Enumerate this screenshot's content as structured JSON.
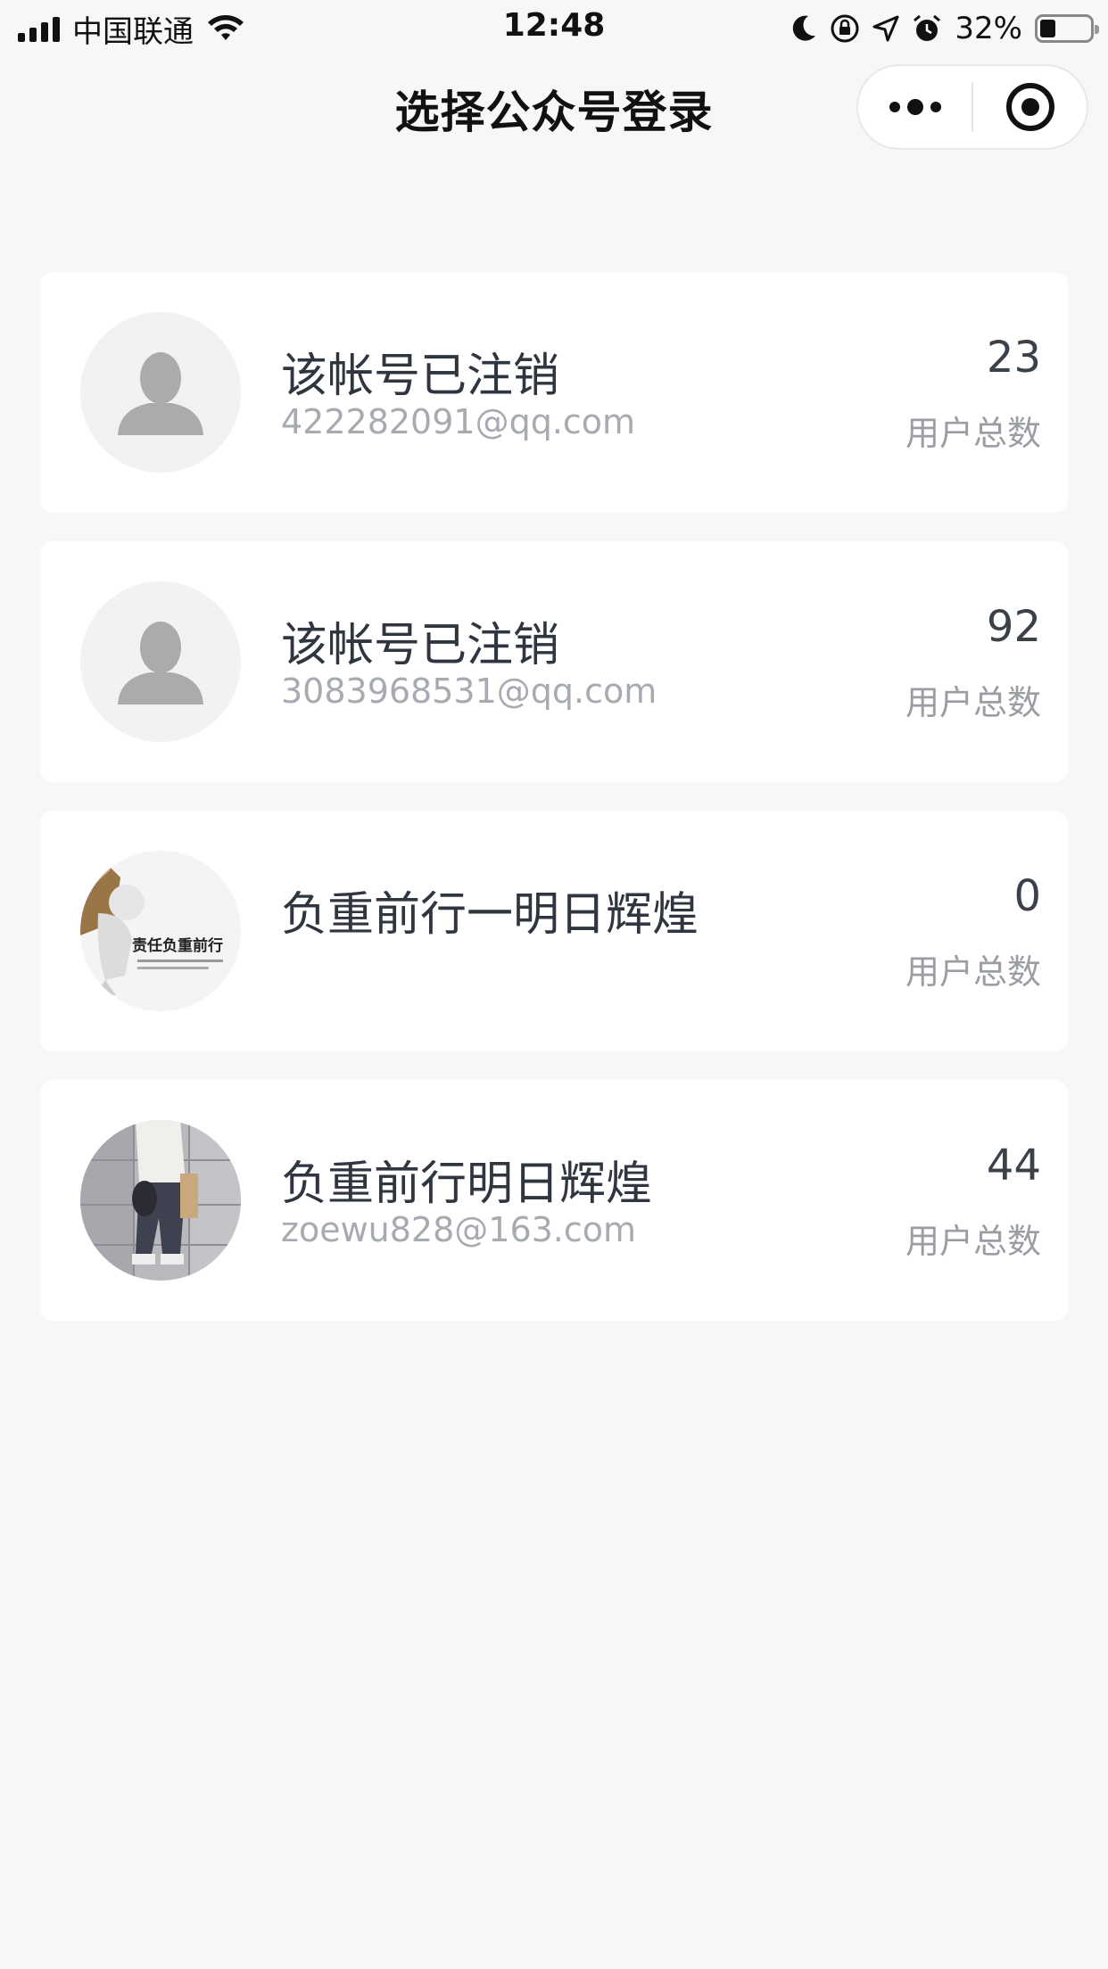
{
  "status_bar": {
    "carrier": "中国联通",
    "time": "12:48",
    "battery": "32%",
    "battery_level": 0.32,
    "icons": [
      "signal-icon",
      "wifi-icon",
      "moon-icon",
      "rotation-lock-icon",
      "location-icon",
      "alarm-icon",
      "battery-icon"
    ]
  },
  "nav": {
    "title": "选择公众号登录",
    "icons": [
      "more-icon",
      "close-target-icon"
    ]
  },
  "accounts": [
    {
      "name": "该帐号已注销",
      "email": "422282091@qq.com",
      "count": "23",
      "count_label": "用户总数",
      "avatar": "default-user-avatar"
    },
    {
      "name": "该帐号已注销",
      "email": "3083968531@qq.com",
      "count": "92",
      "count_label": "用户总数",
      "avatar": "default-user-avatar"
    },
    {
      "name": "负重前行一明日辉煌",
      "email": "",
      "count": "0",
      "count_label": "用户总数",
      "avatar": "carrying-box-figure-avatar",
      "avatar_text": "责任负重前行"
    },
    {
      "name": "负重前行明日辉煌",
      "email": "zoewu828@163.com",
      "count": "44",
      "count_label": "用户总数",
      "avatar": "person-photo-avatar"
    }
  ],
  "colors": {
    "background": "#f6f7f7",
    "card": "#ffffff",
    "text": "#2f3640",
    "muted": "#a7abb1"
  }
}
